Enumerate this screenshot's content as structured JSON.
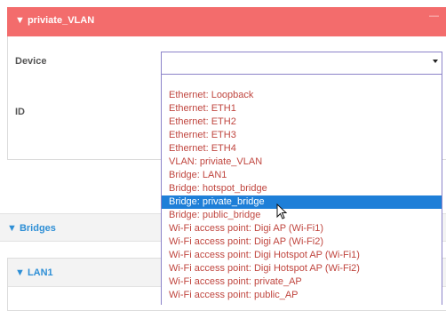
{
  "vlan_panel": {
    "title": "priviate_VLAN",
    "device_label": "Device",
    "id_label": "ID",
    "device_value": ""
  },
  "bridges": {
    "label": "Bridges"
  },
  "lan1": {
    "label": "LAN1"
  },
  "dropdown": {
    "selected_index": 8,
    "options": [
      "Ethernet: Loopback",
      "Ethernet: ETH1",
      "Ethernet: ETH2",
      "Ethernet: ETH3",
      "Ethernet: ETH4",
      "VLAN: priviate_VLAN",
      "Bridge: LAN1",
      "Bridge: hotspot_bridge",
      "Bridge: private_bridge",
      "Bridge: public_bridge",
      "Wi-Fi access point: Digi AP (Wi-Fi1)",
      "Wi-Fi access point: Digi AP (Wi-Fi2)",
      "Wi-Fi access point: Digi Hotspot AP (Wi-Fi1)",
      "Wi-Fi access point: Digi Hotspot AP (Wi-Fi2)",
      "Wi-Fi access point: private_AP",
      "Wi-Fi access point: public_AP"
    ]
  },
  "colors": {
    "header_red": "#f36c6c",
    "link_blue": "#2e8fd6",
    "option_text": "#c0463f",
    "selected_bg": "#1e7fd8",
    "focus_border": "#8b83c9"
  },
  "icons": {
    "expand_arrow": "▼",
    "collapse_mark": "—",
    "cursor": "mouse-pointer-icon"
  }
}
